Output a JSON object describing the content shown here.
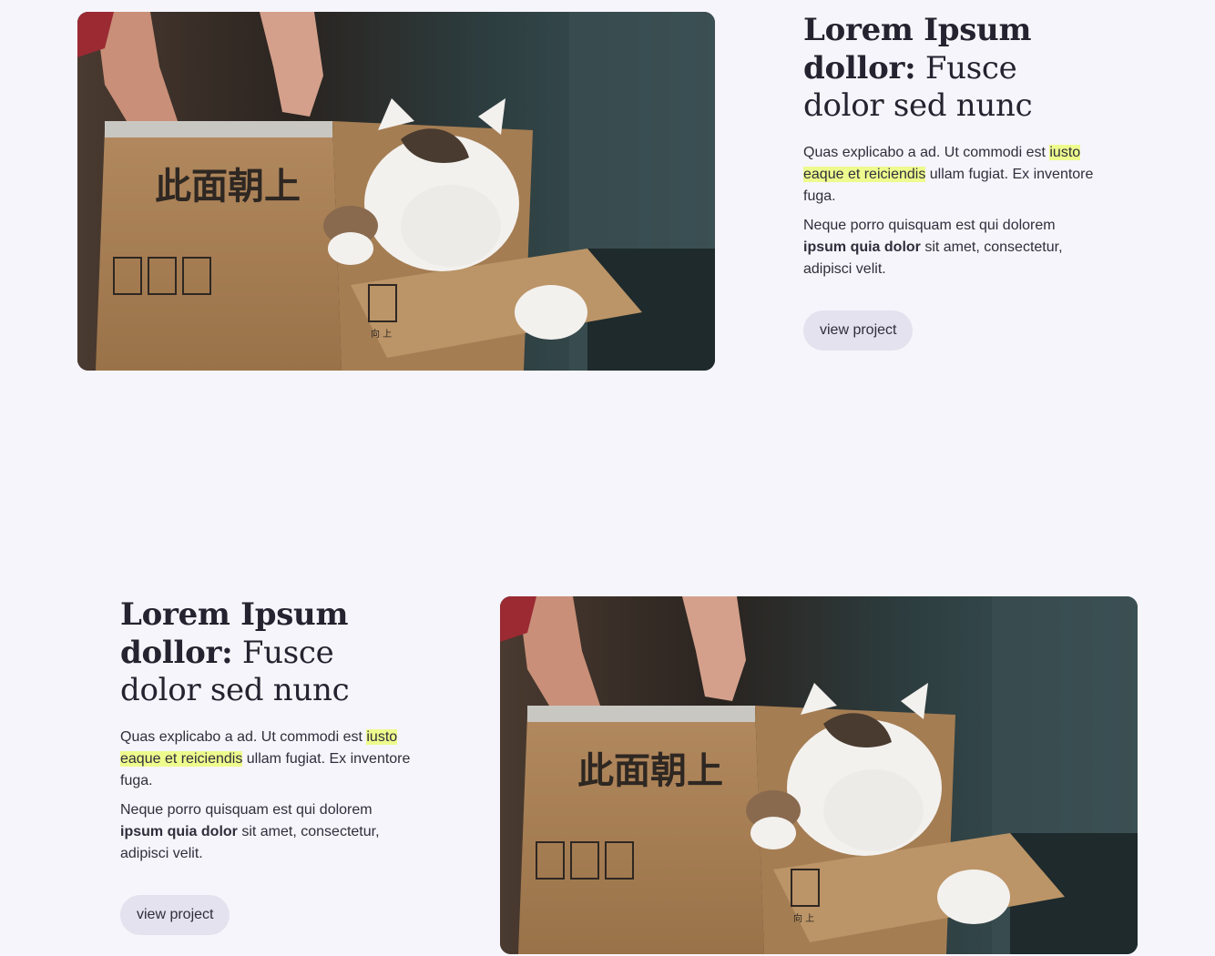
{
  "projects": [
    {
      "title_bold": "Lorem Ipsum dollor:",
      "title_regular": "Fusce dolor sed nunc",
      "para1_a": "Quas explicabo a ad. Ut commodi est ",
      "para1_highlight": "iusto eaque et reiciendis",
      "para1_b": " ullam fugiat. Ex inventore fuga.",
      "para2_a": "Neque porro quisquam est qui dolorem ",
      "para2_bold": "ipsum quia dolor",
      "para2_b": " sit amet, consectetur, adipisci velit.",
      "button_label": "view project",
      "box_label": "此面朝上",
      "box_small_label": "向 上"
    },
    {
      "title_bold": "Lorem Ipsum dollor:",
      "title_regular": "Fusce dolor sed nunc",
      "para1_a": "Quas explicabo a ad. Ut commodi est ",
      "para1_highlight": "iusto eaque et reiciendis",
      "para1_b": " ullam fugiat. Ex inventore fuga.",
      "para2_a": "Neque porro quisquam est qui dolorem ",
      "para2_bold": "ipsum quia dolor",
      "para2_b": " sit amet, consectetur, adipisci velit.",
      "button_label": "view project",
      "box_label": "此面朝上",
      "box_small_label": "向 上"
    }
  ],
  "colors": {
    "background": "#f6f5fb",
    "highlight": "#eefb8d",
    "button_bg": "#e4e2ee",
    "text": "#24232f"
  }
}
